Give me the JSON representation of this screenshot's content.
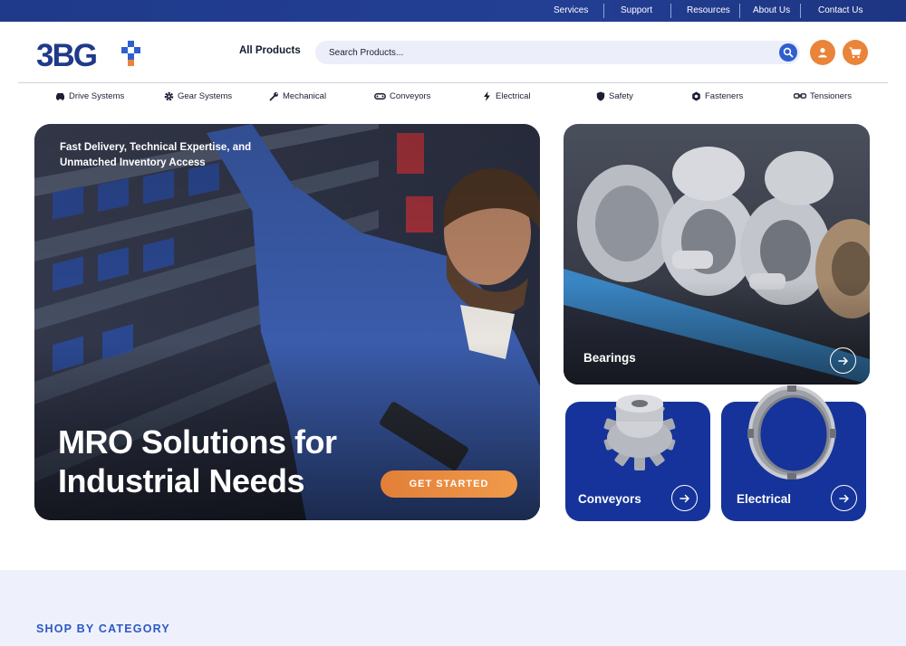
{
  "topbar": {
    "links": [
      "Services",
      "Support",
      "Resources",
      "About Us",
      "Contact Us"
    ]
  },
  "header": {
    "logo_text": "3BG",
    "all_products": "All Products",
    "search_placeholder": "Search Products..."
  },
  "category_nav": [
    {
      "label": "Drive Systems",
      "icon": "car-icon"
    },
    {
      "label": "Gear Systems",
      "icon": "gear-icon"
    },
    {
      "label": "Mechanical",
      "icon": "wrench-icon"
    },
    {
      "label": "Conveyors",
      "icon": "belt-icon"
    },
    {
      "label": "Electrical",
      "icon": "bolt-icon"
    },
    {
      "label": "Safety",
      "icon": "shield-icon"
    },
    {
      "label": "Fasteners",
      "icon": "nut-icon"
    },
    {
      "label": "Tensioners",
      "icon": "chain-icon"
    }
  ],
  "hero": {
    "tagline": "Fast Delivery, Technical Expertise, and Unmatched Inventory Access",
    "title": "MRO Solutions for Industrial Needs",
    "cta": "GET STARTED"
  },
  "cards": {
    "bearings": "Bearings",
    "conveyors": "Conveyors",
    "electrical": "Electrical"
  },
  "shop": {
    "title": "SHOP BY CATEGORY"
  },
  "colors": {
    "brand_blue": "#1f3a8a",
    "accent_orange": "#e9843a",
    "card_blue": "#15339a"
  }
}
